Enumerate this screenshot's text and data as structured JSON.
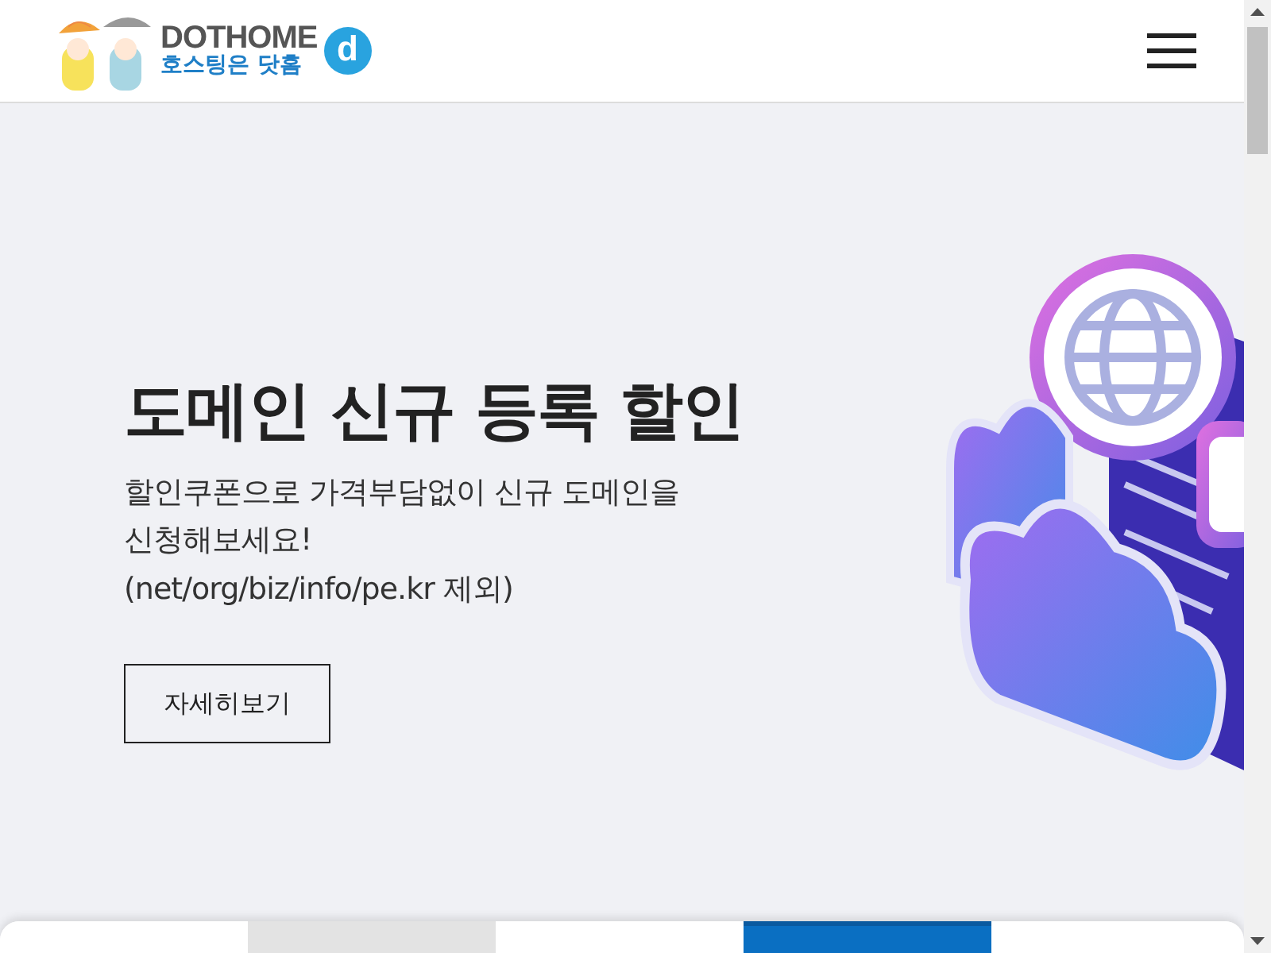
{
  "header": {
    "logo": {
      "name": "DOTHOME",
      "tagline": "호스팅은 닷홈",
      "mark": "d"
    }
  },
  "hero": {
    "title": "도메인 신규 등록 할인",
    "description": [
      "할인쿠폰으로 가격부담없이 신규 도메인을",
      "신청해보세요!",
      "(net/org/biz/info/pe.kr 제외)"
    ],
    "button": "자세히보기"
  },
  "bottom_tabs": [
    {
      "selected": false,
      "color": "#ffffff"
    },
    {
      "selected": false,
      "color": "#e3e3e3"
    },
    {
      "selected": false,
      "color": "#ffffff"
    },
    {
      "selected": true,
      "color": "#0a6fc2"
    },
    {
      "selected": false,
      "color": "#ffffff"
    }
  ]
}
